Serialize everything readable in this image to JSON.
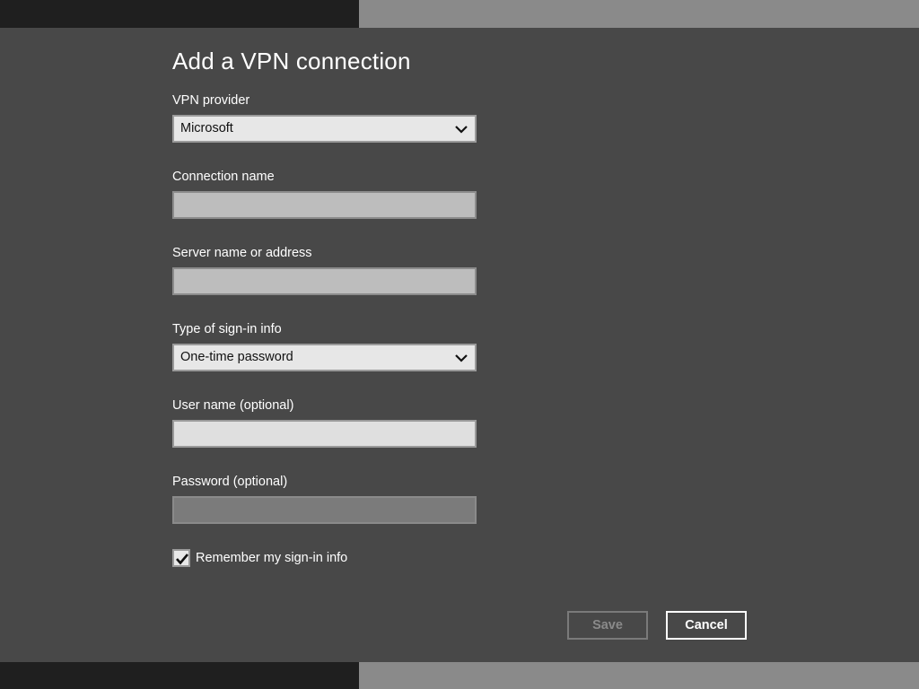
{
  "dialog": {
    "title": "Add a VPN connection",
    "vpn_provider": {
      "label": "VPN provider",
      "value": "Microsoft"
    },
    "connection_name": {
      "label": "Connection name",
      "value": ""
    },
    "server": {
      "label": "Server name or address",
      "value": ""
    },
    "signin_type": {
      "label": "Type of sign-in info",
      "value": "One-time password"
    },
    "username": {
      "label": "User name (optional)",
      "value": ""
    },
    "password": {
      "label": "Password (optional)",
      "value": ""
    },
    "remember": {
      "label": "Remember my sign-in info",
      "checked": true
    },
    "buttons": {
      "save": "Save",
      "cancel": "Cancel"
    }
  },
  "colors": {
    "dialog_bg": "#484848",
    "text": "#ffffff",
    "field_bg": "#e7e7e7",
    "disabled_text": "#8a8a8a"
  },
  "icons": [
    "chevron-down-icon",
    "checkmark-icon"
  ]
}
